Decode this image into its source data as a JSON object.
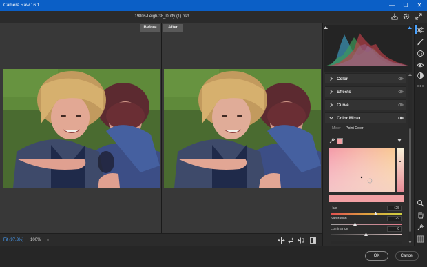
{
  "window": {
    "title": "Camera Raw 16.1",
    "filename": "1980s-Leigh-38_Duffy (1).psd",
    "minimize": "—",
    "maximize": "☐",
    "close": "✕"
  },
  "viewer": {
    "before_label": "Before",
    "after_label": "After"
  },
  "bottombar": {
    "fit_label": "Fit (97.3%)",
    "zoom_value": "100%",
    "zoom_chevron": "⌄"
  },
  "panel": {
    "sections": [
      {
        "label": "Color",
        "expanded": false
      },
      {
        "label": "Effects",
        "expanded": false
      },
      {
        "label": "Curve",
        "expanded": false
      },
      {
        "label": "Color Mixer",
        "expanded": true
      }
    ],
    "color_mixer": {
      "tabs": [
        "Mixer",
        "Point Color"
      ],
      "active_tab": "Point Color",
      "swatch_color": "#f2a0a4",
      "sliders": [
        {
          "label": "Hue",
          "value": "+25"
        },
        {
          "label": "Saturation",
          "value": "-29"
        },
        {
          "label": "Luminance",
          "value": "0"
        }
      ]
    }
  },
  "footer": {
    "ok_label": "OK",
    "cancel_label": "Cancel"
  },
  "colors": {
    "titlebar": "#0b5fc6",
    "accent_blue": "#4aa3ff",
    "panel_bg": "#2c2c2c"
  },
  "icons": [
    "save-icon",
    "settings-gear-icon",
    "fullscreen-icon",
    "edit-sliders-icon",
    "brush-icon",
    "masking-icon",
    "redeye-icon",
    "presets-icon",
    "more-icon",
    "zoom-icon",
    "hand-icon",
    "sampler-icon",
    "grid-icon"
  ]
}
